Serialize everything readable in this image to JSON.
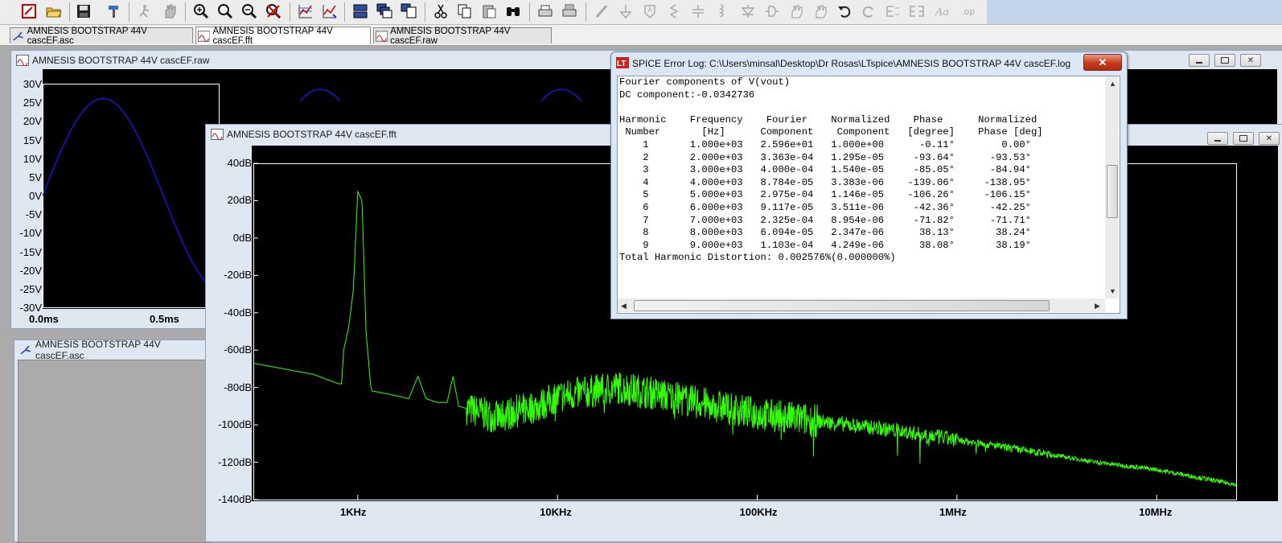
{
  "toolbar": {
    "icons": [
      "new-schematic-icon",
      "open-icon",
      "save-icon",
      "hammer-icon",
      "run-icon",
      "halt-icon",
      "zoom-in-icon",
      "zoom-out-icon",
      "zoom-fit-icon",
      "cancel-zoom-icon",
      "autorange-icon",
      "manual-limits-icon",
      "tile-horizontal-icon",
      "cascade-icon",
      "tile-vertical-icon",
      "cut-icon",
      "copy-icon",
      "paste-icon",
      "find-icon",
      "print-icon",
      "print-preview-icon",
      "draw-wire-icon",
      "ground-icon",
      "label-net-icon",
      "resistor-icon",
      "capacitor-icon",
      "inductor-icon",
      "diode-icon",
      "component-icon",
      "move-icon",
      "drag-icon",
      "undo-icon",
      "redo-icon",
      "rotate-icon",
      "mirror-icon",
      "text-icon",
      "spice-directive-icon"
    ]
  },
  "tabs": [
    {
      "label": "AMNESIS BOOTSTRAP 44V cascEF.asc",
      "icon": "schematic-icon",
      "active": false
    },
    {
      "label": "AMNESIS BOOTSTRAP 44V cascEF.fft",
      "icon": "waveform-icon",
      "active": true
    },
    {
      "label": "AMNESIS BOOTSTRAP 44V cascEF.raw",
      "icon": "waveform-icon",
      "active": false
    }
  ],
  "raw_window": {
    "title": "AMNESIS BOOTSTRAP 44V cascEF.raw",
    "y_ticks": [
      "30V",
      "25V",
      "20V",
      "15V",
      "10V",
      "5V",
      "0V",
      "-5V",
      "-10V",
      "-15V",
      "-20V",
      "-25V",
      "-30V"
    ],
    "x_ticks": [
      "0.0ms",
      "0.5ms"
    ],
    "trace_color": "#1a1aff"
  },
  "asc_window": {
    "title": "AMNESIS BOOTSTRAP 44V cascEF.asc"
  },
  "fft_window": {
    "title": "AMNESIS BOOTSTRAP 44V cascEF.fft",
    "trace_color": "#33ff00",
    "chart_data": {
      "type": "line",
      "title": "",
      "xlabel": "",
      "ylabel": "",
      "x_scale": "log",
      "xlim": [
        300,
        25000000
      ],
      "ylim": [
        -140,
        40
      ],
      "y_ticks": [
        "40dB",
        "20dB",
        "0dB",
        "-20dB",
        "-40dB",
        "-60dB",
        "-80dB",
        "-100dB",
        "-120dB",
        "-140dB"
      ],
      "x_ticks": [
        "1KHz",
        "10KHz",
        "100KHz",
        "1MHz",
        "10MHz"
      ],
      "x_tick_values": [
        1000,
        10000,
        100000,
        1000000,
        10000000
      ],
      "series": [
        {
          "x": [
            300,
            600,
            800,
            830,
            850,
            900,
            950,
            1000,
            1050,
            1100,
            1160,
            1180,
            1200,
            1500,
            1800,
            2000,
            2200,
            2500,
            2800,
            3000,
            3200,
            4000,
            5000,
            6000,
            8000,
            10000,
            15000,
            20000,
            30000,
            50000,
            100000,
            200000,
            500000,
            1000000,
            2000000,
            5000000,
            10000000,
            25000000
          ],
          "y": [
            -67,
            -73,
            -78,
            -78,
            -60,
            -48,
            -28,
            25,
            20,
            -50,
            -79,
            -82,
            -82,
            -84,
            -86,
            -74,
            -86,
            -88,
            -88,
            -74,
            -90,
            -93,
            -96,
            -93,
            -90,
            -85,
            -82,
            -80,
            -83,
            -88,
            -94,
            -98,
            -103,
            -108,
            -113,
            -120,
            -124,
            -132
          ]
        }
      ]
    }
  },
  "error_log": {
    "title": "SPICE Error Log: C:\\Users\\minsal\\Desktop\\Dr Rosas\\LTspice\\AMNESIS BOOTSTRAP 44V cascEF.log",
    "close_label": "✕",
    "text": "Fourier components of V(vout)\nDC component:-0.0342736\n\nHarmonic    Frequency    Fourier    Normalized    Phase      Normalized\n Number       [Hz]      Component    Component   [degree]    Phase [deg]\n    1       1.000e+03   2.596e+01   1.000e+00      -0.11°        0.00°\n    2       2.000e+03   3.363e-04   1.295e-05     -93.64°      -93.53°\n    3       3.000e+03   4.000e-04   1.540e-05     -85.05°      -84.94°\n    4       4.000e+03   8.784e-05   3.383e-06    -139.06°     -138.95°\n    5       5.000e+03   2.975e-04   1.146e-05    -106.26°     -106.15°\n    6       6.000e+03   9.117e-05   3.511e-06     -42.36°      -42.25°\n    7       7.000e+03   2.325e-04   8.954e-06     -71.82°      -71.71°\n    8       8.000e+03   6.094e-05   2.347e-06      38.13°       38.24°\n    9       9.000e+03   1.103e-04   4.249e-06      38.08°       38.19°\nTotal Harmonic Distortion: 0.002576%(0.000000%)"
  }
}
